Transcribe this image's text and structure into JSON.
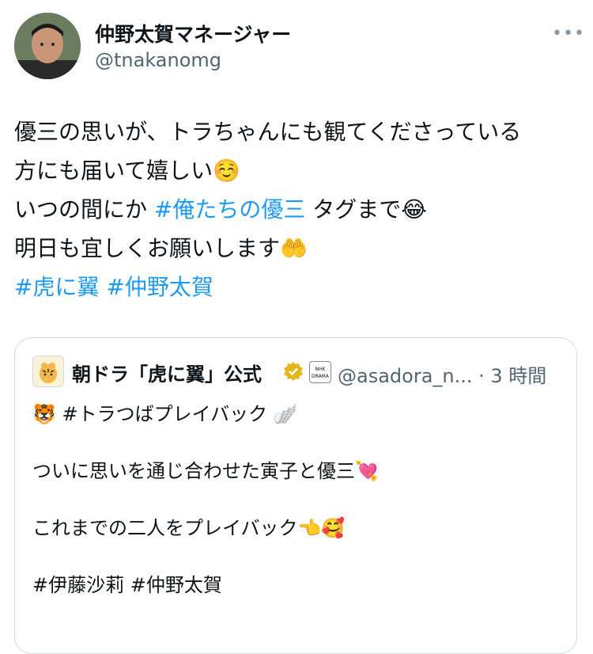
{
  "author": {
    "display_name": "仲野太賀マネージャー",
    "handle": "@tnakanomg"
  },
  "more_label": "•••",
  "tweet": {
    "line1": "優三の思いが、トラちゃんにも観てくださっている",
    "line2_text": "方にも届いて嬉しい",
    "line2_emoji": "☺️",
    "line3_pre": "いつの間にか ",
    "line3_tag": "#俺たちの優三",
    "line3_post": " タグまで",
    "line3_emoji": "😂",
    "line4_text": "明日も宜しくお願いします",
    "line4_emoji": "🤲",
    "hashtag1": "#虎に翼",
    "hashtag2": "#仲野太賀"
  },
  "quote": {
    "display_name": "朝ドラ「虎に翼」公式",
    "nhk_badge": "NHK DRAMA",
    "handle_time": "@asadora_n... · 3 時間",
    "line1": "🐯 #トラつばプレイバック 🪽",
    "line2": "ついに思いを通じ合わせた寅子と優三💘",
    "line3": "これまでの二人をプレイバック👈🥰",
    "line4": "#伊藤沙莉 #仲野太賀"
  }
}
